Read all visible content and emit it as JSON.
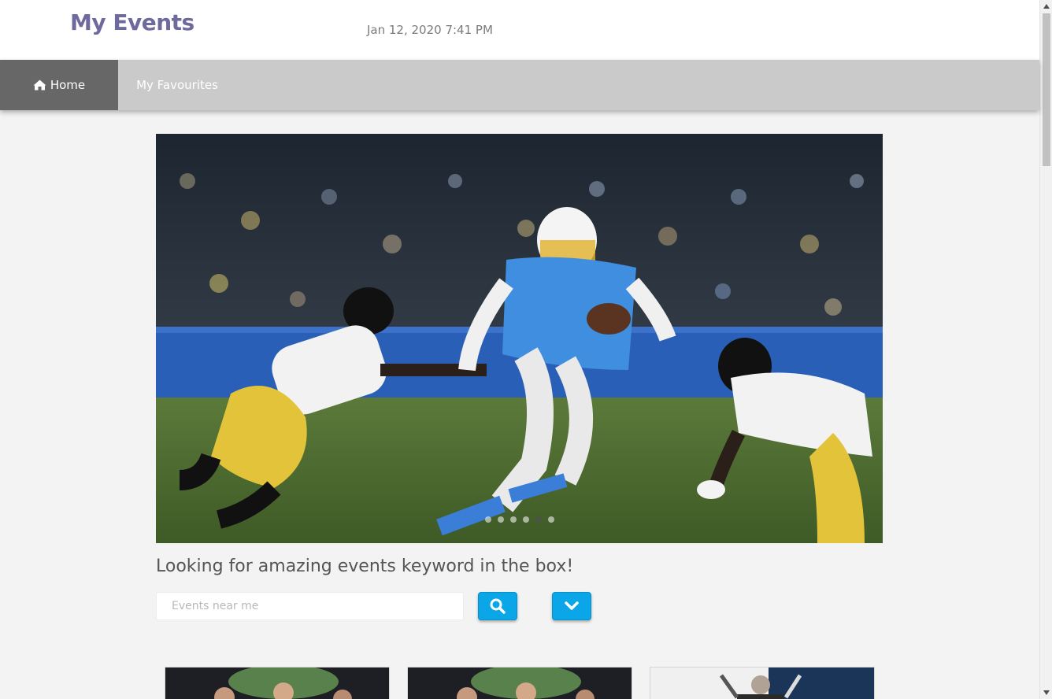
{
  "header": {
    "brand": "My Events",
    "datetime": "Jan 12, 2020 7:41 PM"
  },
  "nav": {
    "items": [
      {
        "label": "Home",
        "icon": "home-icon",
        "active": true
      },
      {
        "label": "My Favourites",
        "active": false
      }
    ]
  },
  "carousel": {
    "slides": 6,
    "active_slide": 5,
    "image": "football-game-photo"
  },
  "search": {
    "tagline": "Looking for amazing events keyword in the box!",
    "placeholder": "Events near me",
    "search_icon": "search-icon",
    "expand_icon": "chevron-down-icon"
  },
  "colors": {
    "brand": "#6e6a9e",
    "nav_bg": "#cacaca",
    "nav_active": "#676767",
    "button": "#0aa6e8",
    "page_bg": "#f3f3f3"
  }
}
